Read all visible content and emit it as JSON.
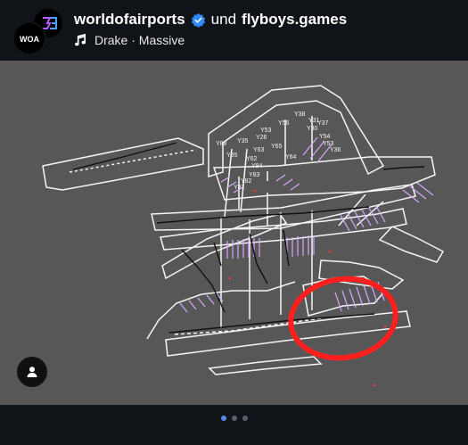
{
  "post": {
    "author_primary": "worldofairports",
    "collab_word": "und",
    "author_secondary": "flyboys.games",
    "music": "Drake · Massive",
    "avatar_text": "WOA"
  },
  "map": {
    "stand_labels": [
      "Y38",
      "Y31",
      "Y30",
      "Y56",
      "Y53",
      "Y26",
      "Y35",
      "Y88",
      "Y85",
      "Y36",
      "Y84",
      "Y83",
      "Y82",
      "Y81",
      "Y65",
      "Y64",
      "Y63",
      "Y62",
      "Y54",
      "Y53",
      "Y37"
    ],
    "highlight_color": "#ff1f1f",
    "line_color": "#f5f5f5",
    "accent_color": "#d8a6ff"
  },
  "carousel": {
    "count": 3,
    "active": 1
  },
  "colors": {
    "background": "#101317",
    "image_bg": "#575757",
    "verified": "#2f8cff",
    "active_dot": "#5b87e8"
  }
}
